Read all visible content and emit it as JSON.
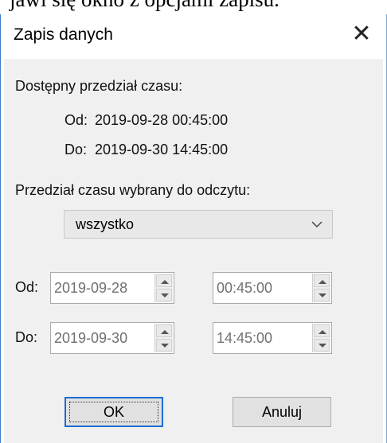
{
  "background_text": "jawi się okno z opcjami zapisu.",
  "dialog": {
    "title": "Zapis danych",
    "close_symbol": "✕",
    "available_range_label": "Dostępny przedział czasu:",
    "available_from_label": "Od:",
    "available_from_value": "2019-09-28 00:45:00",
    "available_to_label": "Do:",
    "available_to_value": "2019-09-30 14:45:00",
    "selected_range_label": "Przedział czasu wybrany do odczytu:",
    "range_select": {
      "selected": "wszystko"
    },
    "from_label": "Od:",
    "from_date": "2019-09-28",
    "from_time": "00:45:00",
    "to_label": "Do:",
    "to_date": "2019-09-30",
    "to_time": "14:45:00",
    "ok_label": "OK",
    "cancel_label": "Anuluj"
  },
  "colors": {
    "window_border": "#3c7dc2",
    "default_button_border": "#1b6cd1",
    "client_bg": "#f0f0f0"
  },
  "icons": [
    "close-icon",
    "chevron-down-icon",
    "spin-up-icon",
    "spin-down-icon"
  ]
}
